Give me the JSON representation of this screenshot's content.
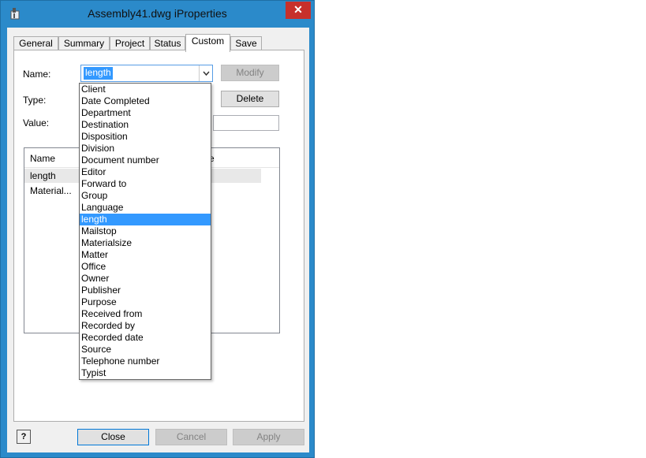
{
  "window": {
    "title": "Assembly41.dwg iProperties",
    "close_glyph": "✕"
  },
  "tabs": [
    "General",
    "Summary",
    "Project",
    "Status",
    "Custom",
    "Save"
  ],
  "active_tab": "Custom",
  "form": {
    "name_label": "Name:",
    "type_label": "Type:",
    "value_label": "Value:",
    "name_value": "length",
    "modify_label": "Modify",
    "delete_label": "Delete"
  },
  "list": {
    "col_name": "Name",
    "col_value_fragment": "e",
    "rows": [
      "length",
      "Material..."
    ]
  },
  "dropdown": {
    "items": [
      "Client",
      "Date Completed",
      "Department",
      "Destination",
      "Disposition",
      "Division",
      "Document number",
      "Editor",
      "Forward to",
      "Group",
      "Language",
      "length",
      "Mailstop",
      "Materialsize",
      "Matter",
      "Office",
      "Owner",
      "Publisher",
      "Purpose",
      "Received from",
      "Recorded by",
      "Recorded date",
      "Source",
      "Telephone number",
      "Typist"
    ],
    "selected": "length"
  },
  "footer": {
    "help_glyph": "?",
    "close_label": "Close",
    "cancel_label": "Cancel",
    "apply_label": "Apply"
  },
  "colors": {
    "accent": "#3399ff",
    "titlebar": "#2b8aca",
    "close": "#c7302b"
  }
}
